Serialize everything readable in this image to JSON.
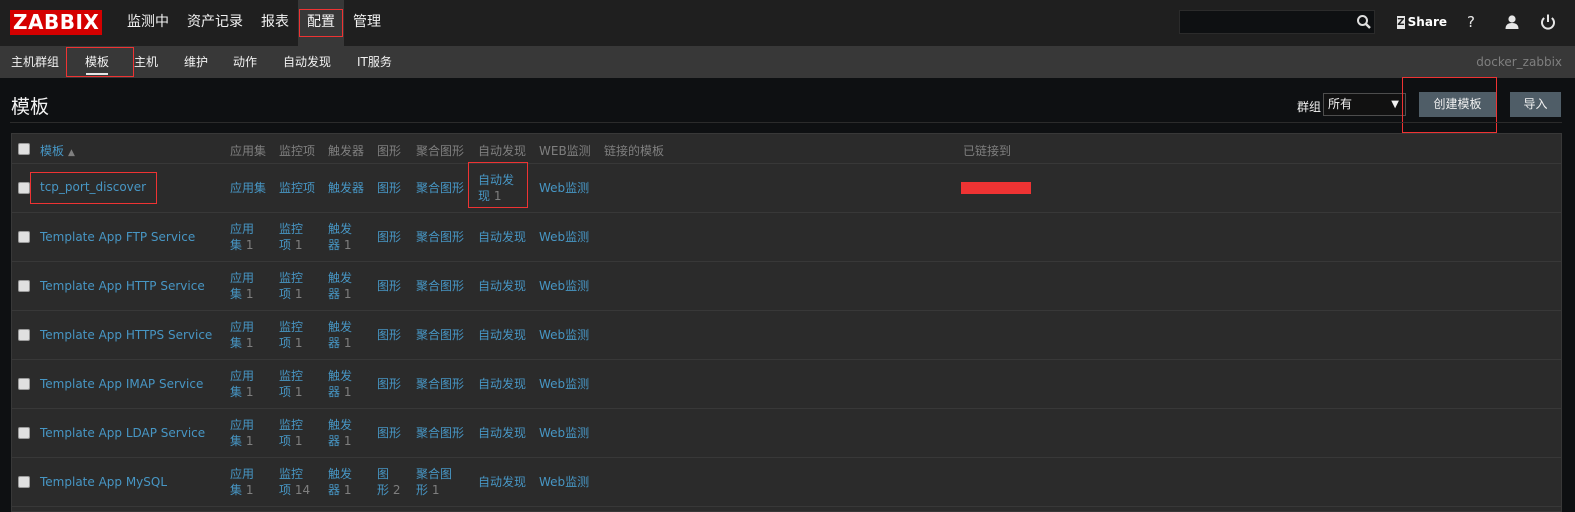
{
  "logo": "ZABBIX",
  "main_menu": [
    {
      "label": "监测中"
    },
    {
      "label": "资产记录"
    },
    {
      "label": "报表"
    },
    {
      "label": "配置"
    },
    {
      "label": "管理"
    }
  ],
  "topbar": {
    "share_label": "Share",
    "share_logo": "Z",
    "help_label": "?"
  },
  "sub_menu": [
    {
      "label": "主机群组"
    },
    {
      "label": "模板"
    },
    {
      "label": "主机"
    },
    {
      "label": "维护"
    },
    {
      "label": "动作"
    },
    {
      "label": "自动发现"
    },
    {
      "label": "IT服务"
    }
  ],
  "server_name": "docker_zabbix",
  "page_title": "模板",
  "filter": {
    "group_label": "群组",
    "group_value": "所有"
  },
  "buttons": {
    "create": "创建模板",
    "import": "导入"
  },
  "columns": {
    "template": "模板",
    "applications": "应用集",
    "items": "监控项",
    "triggers": "触发器",
    "graphs": "图形",
    "screens": "聚合图形",
    "discovery": "自动发现",
    "web": "WEB监测",
    "linked_templates": "链接的模板",
    "linked_to": "已链接到"
  },
  "rows": [
    {
      "name": "tcp_port_discover",
      "app_a": "应用集",
      "app_b": "",
      "app_n": "",
      "item_a": "监控项",
      "item_b": "",
      "item_n": "",
      "trig_a": "触发器",
      "trig_b": "",
      "trig_n": "",
      "graph_a": "图形",
      "graph_b": "",
      "graph_n": "",
      "screen_a": "聚合图形",
      "screen_b": "",
      "screen_n": "",
      "disc_a": "自动发",
      "disc_b": "现",
      "disc_n": "1",
      "web": "Web监测"
    },
    {
      "name": "Template App FTP Service",
      "app_a": "应用",
      "app_b": "集",
      "app_n": "1",
      "item_a": "监控",
      "item_b": "项",
      "item_n": "1",
      "trig_a": "触发",
      "trig_b": "器",
      "trig_n": "1",
      "graph_a": "图形",
      "graph_b": "",
      "graph_n": "",
      "screen_a": "聚合图形",
      "screen_b": "",
      "screen_n": "",
      "disc_a": "自动发现",
      "disc_b": "",
      "disc_n": "",
      "web": "Web监测"
    },
    {
      "name": "Template App HTTP Service",
      "app_a": "应用",
      "app_b": "集",
      "app_n": "1",
      "item_a": "监控",
      "item_b": "项",
      "item_n": "1",
      "trig_a": "触发",
      "trig_b": "器",
      "trig_n": "1",
      "graph_a": "图形",
      "graph_b": "",
      "graph_n": "",
      "screen_a": "聚合图形",
      "screen_b": "",
      "screen_n": "",
      "disc_a": "自动发现",
      "disc_b": "",
      "disc_n": "",
      "web": "Web监测"
    },
    {
      "name": "Template App HTTPS Service",
      "app_a": "应用",
      "app_b": "集",
      "app_n": "1",
      "item_a": "监控",
      "item_b": "项",
      "item_n": "1",
      "trig_a": "触发",
      "trig_b": "器",
      "trig_n": "1",
      "graph_a": "图形",
      "graph_b": "",
      "graph_n": "",
      "screen_a": "聚合图形",
      "screen_b": "",
      "screen_n": "",
      "disc_a": "自动发现",
      "disc_b": "",
      "disc_n": "",
      "web": "Web监测"
    },
    {
      "name": "Template App IMAP Service",
      "app_a": "应用",
      "app_b": "集",
      "app_n": "1",
      "item_a": "监控",
      "item_b": "项",
      "item_n": "1",
      "trig_a": "触发",
      "trig_b": "器",
      "trig_n": "1",
      "graph_a": "图形",
      "graph_b": "",
      "graph_n": "",
      "screen_a": "聚合图形",
      "screen_b": "",
      "screen_n": "",
      "disc_a": "自动发现",
      "disc_b": "",
      "disc_n": "",
      "web": "Web监测"
    },
    {
      "name": "Template App LDAP Service",
      "app_a": "应用",
      "app_b": "集",
      "app_n": "1",
      "item_a": "监控",
      "item_b": "项",
      "item_n": "1",
      "trig_a": "触发",
      "trig_b": "器",
      "trig_n": "1",
      "graph_a": "图形",
      "graph_b": "",
      "graph_n": "",
      "screen_a": "聚合图形",
      "screen_b": "",
      "screen_n": "",
      "disc_a": "自动发现",
      "disc_b": "",
      "disc_n": "",
      "web": "Web监测"
    },
    {
      "name": "Template App MySQL",
      "app_a": "应用",
      "app_b": "集",
      "app_n": "1",
      "item_a": "监控",
      "item_b": "项",
      "item_n": "14",
      "trig_a": "触发",
      "trig_b": "器",
      "trig_n": "1",
      "graph_a": "图",
      "graph_b": "形",
      "graph_n": "2",
      "screen_a": "聚合图",
      "screen_b": "形",
      "screen_n": "1",
      "disc_a": "自动发现",
      "disc_b": "",
      "disc_n": "",
      "web": "Web监测"
    }
  ]
}
